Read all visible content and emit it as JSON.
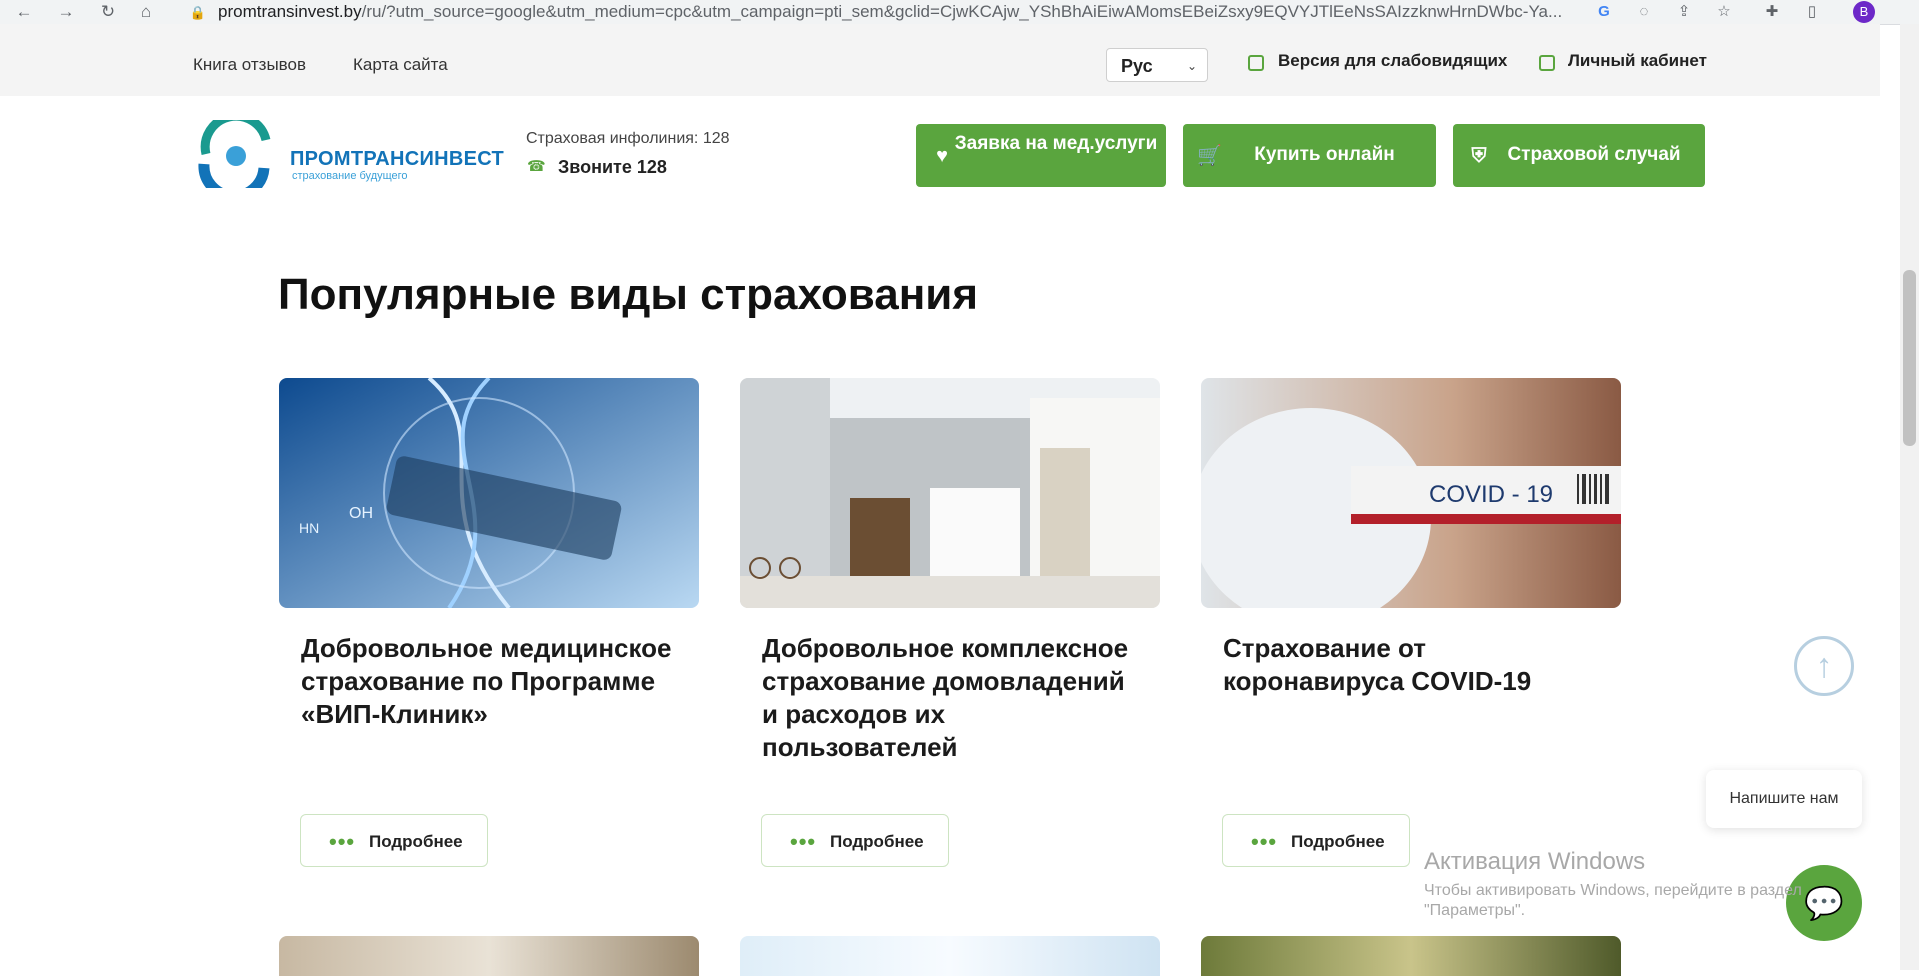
{
  "browser": {
    "url_host": "promtransinvest.by",
    "url_path": "/ru/?utm_source=google&utm_medium=cpc&utm_campaign=pti_sem&gclid=CjwKCAjw_YShBhAiEiwAMomsEBeiZsxy9EQVYJTlEeNsSAIzzknwHrnDWbc-Ya...",
    "profile_initial": "B"
  },
  "topbar": {
    "links": [
      "Книга отзывов",
      "Карта сайта"
    ],
    "language": "Рус",
    "low_vision_label": "Версия для слабовидящих",
    "cabinet_label": "Личный кабинет"
  },
  "header": {
    "logo_name": "ПРОМТРАНСИНВЕСТ",
    "logo_tagline": "страхование будущего",
    "hotline_label": "Страховая инфолиния: 128",
    "hotline_phone": "Звоните 128",
    "buttons": [
      {
        "label": "Заявка на мед.услуги",
        "icon": "heart-pulse-icon"
      },
      {
        "label": "Купить онлайн",
        "icon": "cart-icon"
      },
      {
        "label": "Страховой случай",
        "icon": "shield-icon"
      }
    ]
  },
  "section": {
    "title": "Популярные виды страхования",
    "cards": [
      {
        "title": "Добровольное медицинское страхование по Программе «ВИП-Клиник»",
        "button": "Подробнее"
      },
      {
        "title": "Добровольное комплексное страхование домовладений и расходов их пользователей",
        "button": "Подробнее"
      },
      {
        "title": "Страхование от коронавируса COVID-19",
        "button": "Подробнее",
        "image_text": "COVID - 19"
      }
    ]
  },
  "widgets": {
    "chat_prompt": "Напишите нам"
  },
  "os_watermark": {
    "line1": "Активация Windows",
    "line2": "Чтобы активировать Windows, перейдите в раздел",
    "line3": "\"Параметры\"."
  },
  "colors": {
    "accent_green": "#5aa53e",
    "brand_blue": "#1273b8"
  }
}
